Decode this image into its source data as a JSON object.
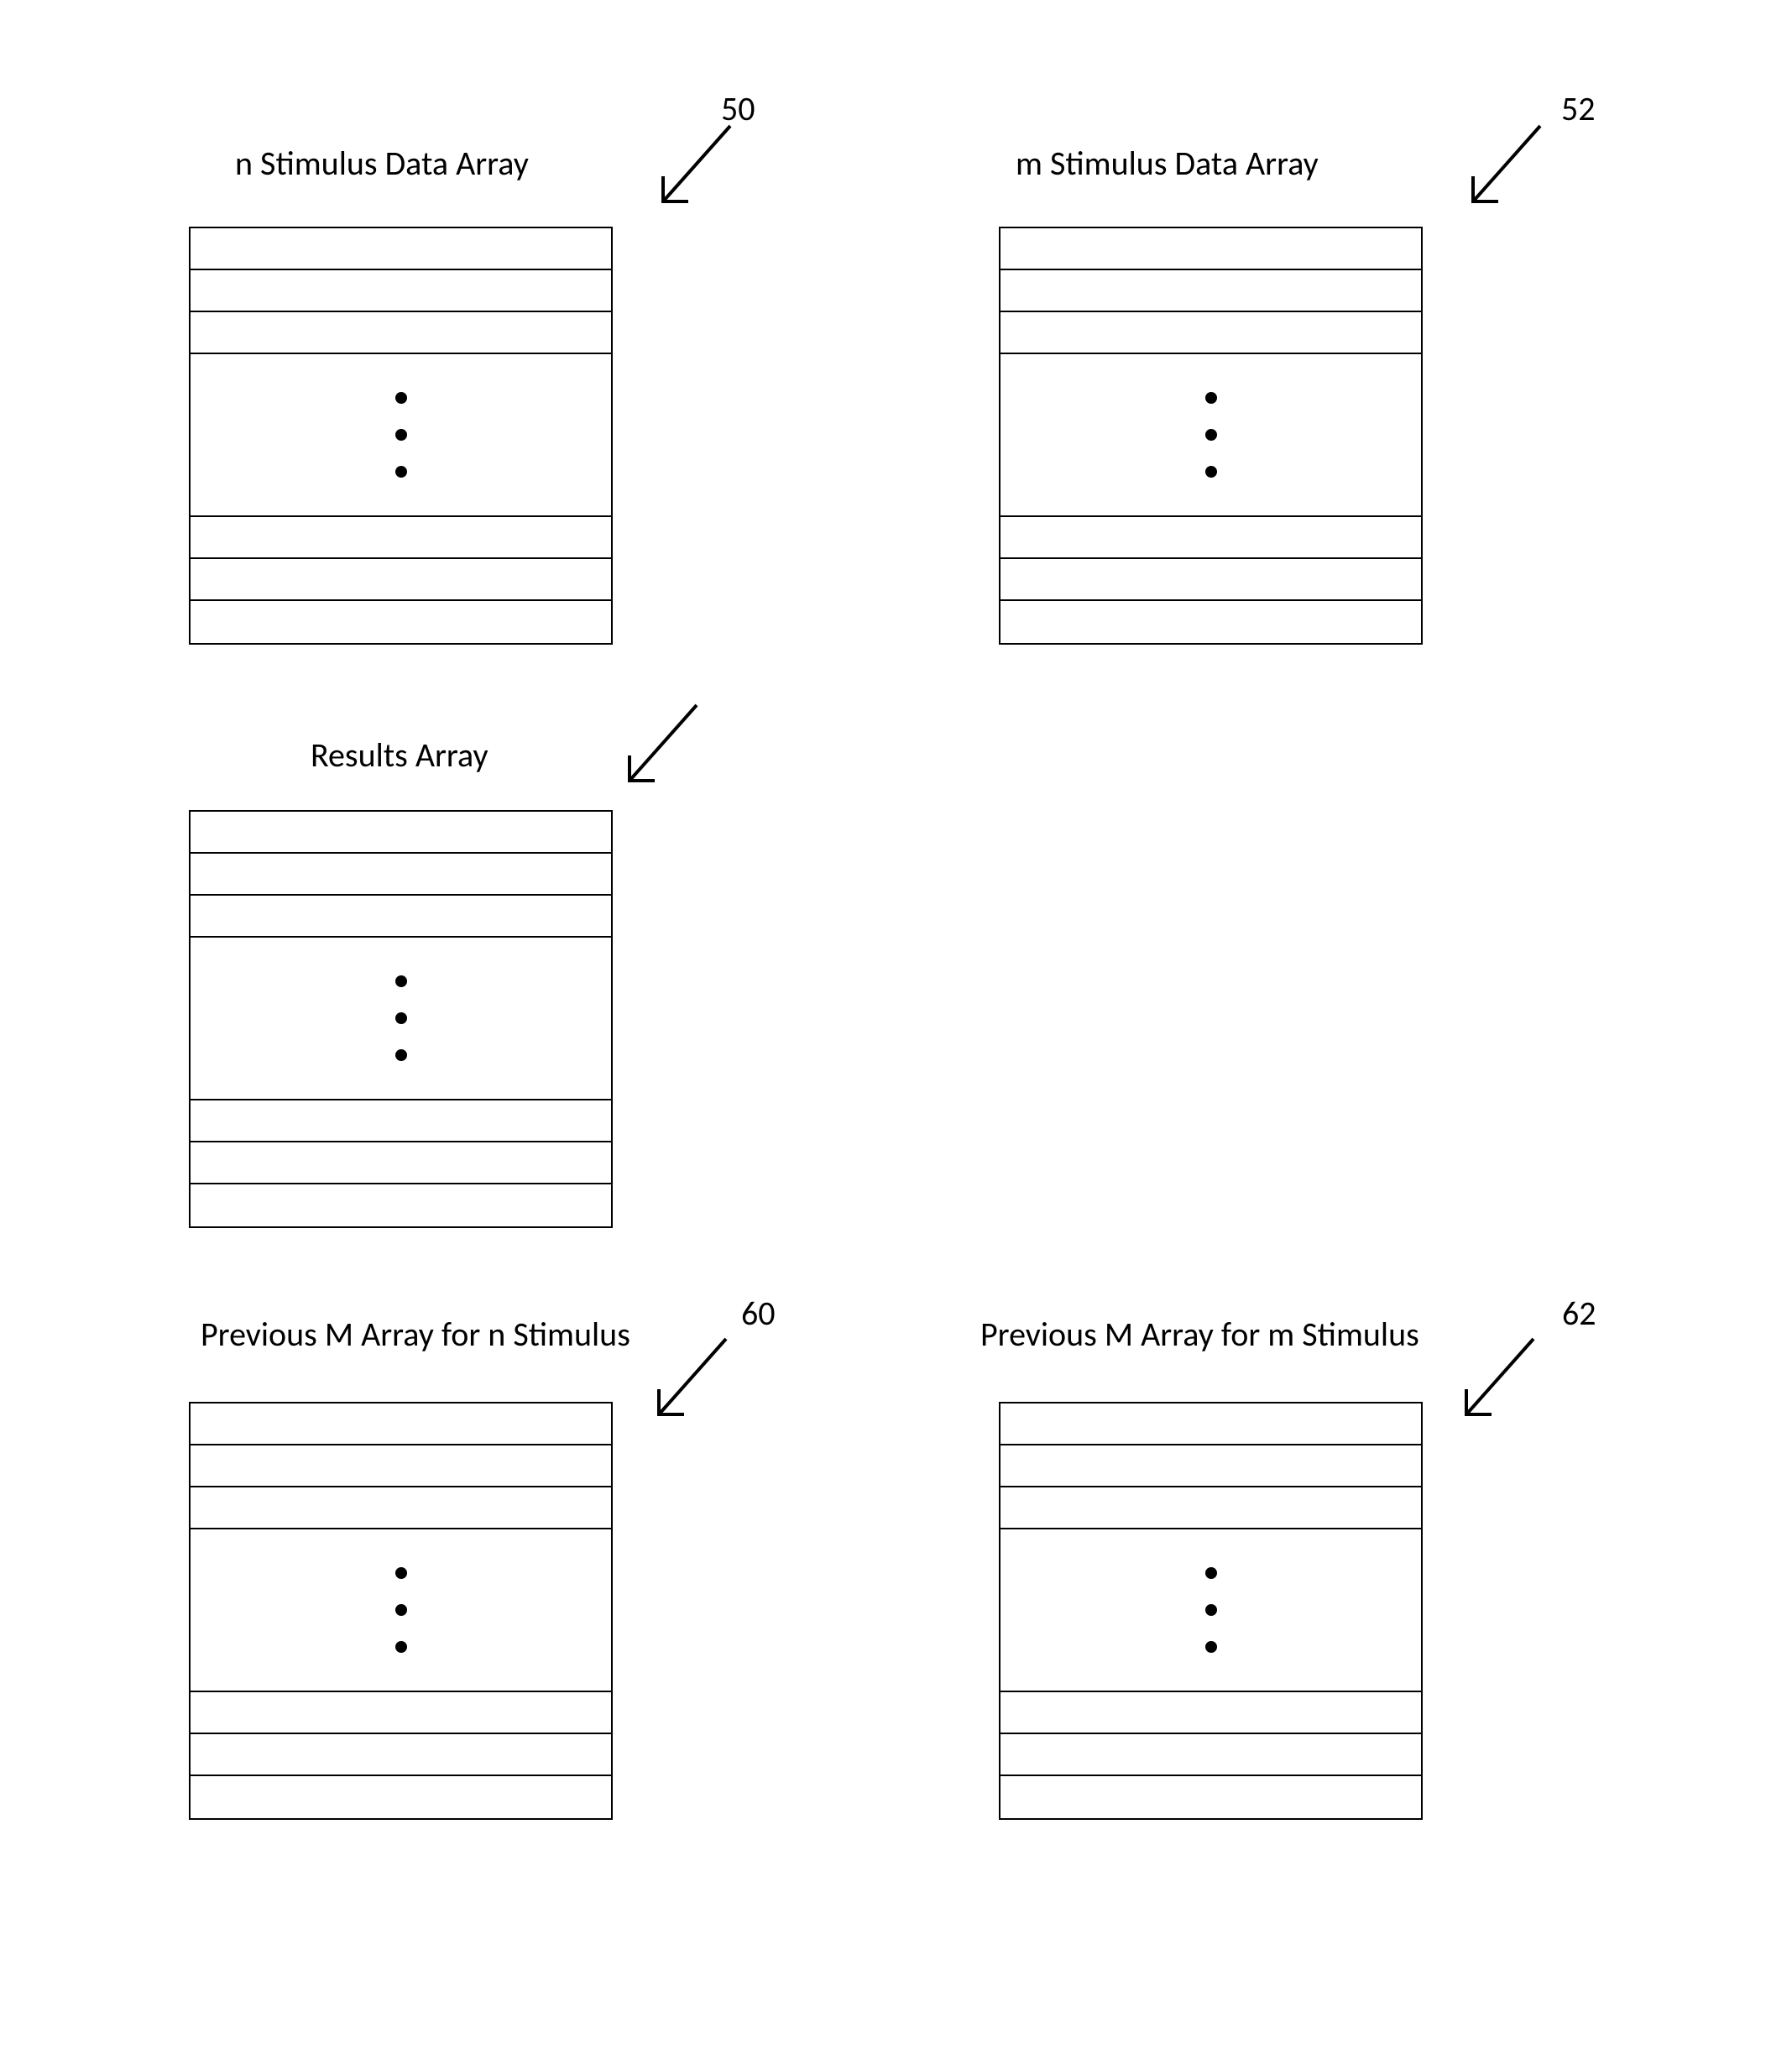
{
  "arrays": {
    "n_stim": {
      "title": "n Stimulus Data Array",
      "ref": "50"
    },
    "m_stim": {
      "title": "m Stimulus Data Array",
      "ref": "52"
    },
    "results": {
      "title": "Results Array",
      "ref": ""
    },
    "prev_n": {
      "title": "Previous M Array for n Stimulus",
      "ref": "60"
    },
    "prev_m": {
      "title": "Previous M Array for m Stimulus",
      "ref": "62"
    }
  }
}
